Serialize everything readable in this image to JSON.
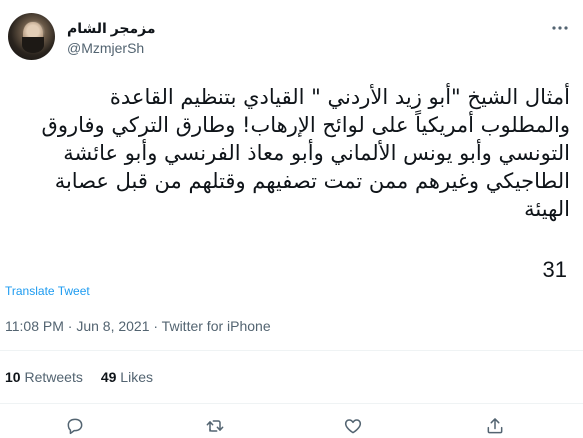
{
  "author": {
    "display_name": "مزمجر الشام",
    "handle": "@MzmjerSh"
  },
  "tweet": {
    "lines": [
      "أمثال الشيخ \"أبو زيد الأردني \" القيادي بتنظيم القاعدة",
      "والمطلوب أمريكياً على لوائح الإرهاب!  وطارق التركي وفاروق",
      "التونسي وأبو يونس الألماني وأبو معاذ الفرنسي وأبو عائشة",
      "الطاجيكي وغيرهم ممن تمت تصفيهم وقتلهم من قبل عصابة",
      "الهيئة"
    ],
    "number": "31",
    "translate_label": "Translate Tweet",
    "timestamp": "11:08 PM · Jun 8, 2021 · Twitter for iPhone"
  },
  "stats": {
    "retweets_count": "10",
    "retweets_label": "Retweets",
    "likes_count": "49",
    "likes_label": "Likes"
  },
  "actions": [
    {
      "icon": "reply-icon"
    },
    {
      "icon": "retweet-icon"
    },
    {
      "icon": "like-icon"
    },
    {
      "icon": "share-icon"
    }
  ],
  "colors": {
    "accent": "#1d9bf0",
    "secondary_text": "#536471",
    "primary_text": "#0f1419",
    "divider": "#eff3f4"
  }
}
